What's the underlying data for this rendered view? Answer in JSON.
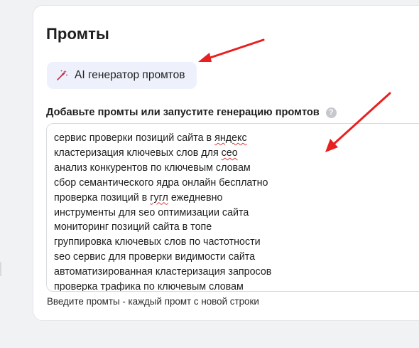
{
  "page": {
    "title": "Промты"
  },
  "ai_button": {
    "label": "AI генератор промтов",
    "icon": "magic-wand-icon"
  },
  "section": {
    "label": "Добавьте промты или запустите генерацию промтов",
    "help_icon": "?"
  },
  "prompts": {
    "lines": [
      {
        "parts": [
          "сервис проверки позиций сайта в ",
          {
            "t": "яндекс",
            "u": true
          }
        ]
      },
      {
        "parts": [
          "кластеризация ключевых слов для ",
          {
            "t": "сео",
            "u": true
          }
        ]
      },
      {
        "parts": [
          "анализ конкурентов по ключевым словам"
        ]
      },
      {
        "parts": [
          "сбор семантического ядра онлайн бесплатно"
        ]
      },
      {
        "parts": [
          "проверка позиций в ",
          {
            "t": "гугл",
            "u": true
          },
          " ежедневно"
        ]
      },
      {
        "parts": [
          "инструменты для seo оптимизации сайта"
        ]
      },
      {
        "parts": [
          "мониторинг позиций сайта в топе"
        ]
      },
      {
        "parts": [
          "группировка ключевых слов по частотности"
        ]
      },
      {
        "parts": [
          "seo сервис для проверки видимости сайта"
        ]
      },
      {
        "parts": [
          "автоматизированная кластеризация запросов"
        ]
      },
      {
        "parts": [
          "проверка трафика по ключевым словам"
        ]
      }
    ]
  },
  "hint": "Введите промты - каждый промт с новой строки",
  "colors": {
    "annotation_arrow": "#e8201f",
    "button_bg": "#eef1fb",
    "spell_underline": "#e23b3b"
  }
}
